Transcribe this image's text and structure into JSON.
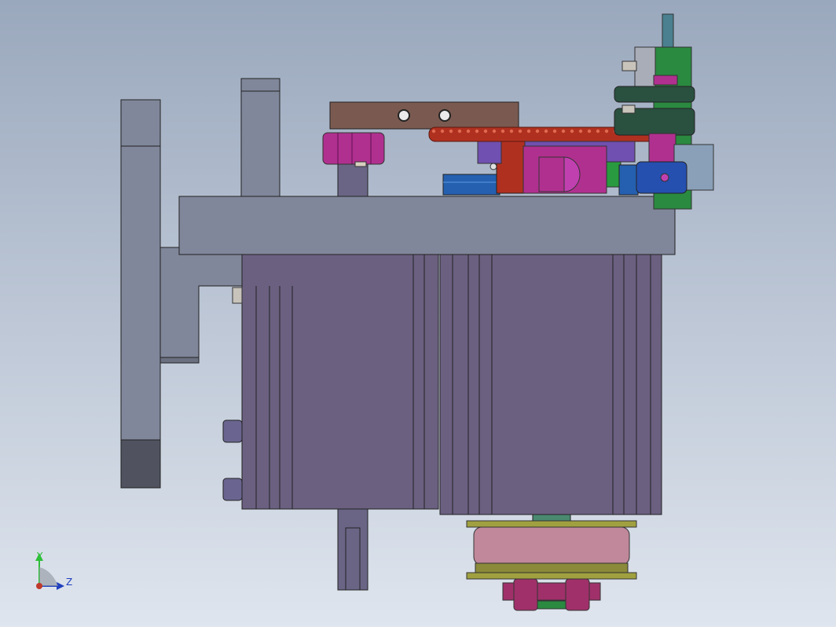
{
  "scene": {
    "background_top": "#9aa8bd",
    "background_bottom": "#dfe5ee"
  },
  "triad": {
    "y_label": "Y",
    "z_label": "Z",
    "y_color": "#2fbf3a",
    "z_color": "#1f3fbf",
    "origin_color": "#c0392b"
  },
  "colors": {
    "plate_grey": "#80879a",
    "plate_dark": "#50535f",
    "motor_purple": "#6b6080",
    "bracket_brown": "#7a5a50",
    "chain_red": "#b03020",
    "magenta": "#b0308f",
    "blue": "#2550b0",
    "green": "#2a8a40",
    "pink": "#c0889a",
    "olive": "#a0a040",
    "steel_blue": "#5a7a9a"
  }
}
